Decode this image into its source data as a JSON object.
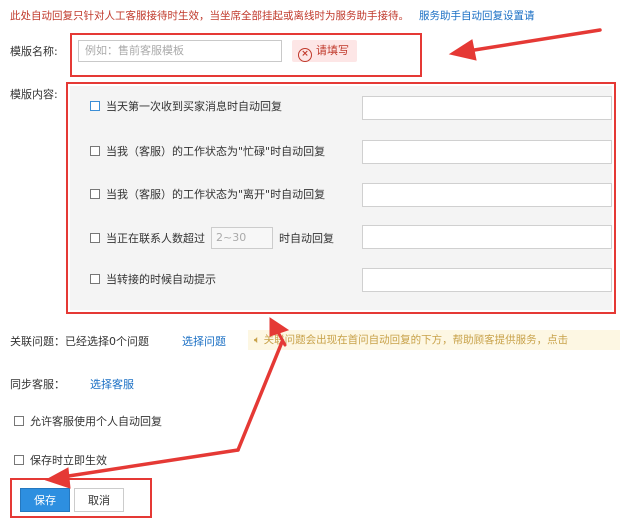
{
  "notice": {
    "warning": "此处自动回复只针对人工客服接待时生效，当坐席全部挂起或离线时为服务助手接待。",
    "link": "服务助手自动回复设置请"
  },
  "template_name": {
    "label": "模版名称:",
    "placeholder": "例如：售前客服模板",
    "error_icon": "close-circle-icon",
    "error": "请填写"
  },
  "template_content": {
    "label": "模版内容:",
    "rules": [
      {
        "label": "当天第一次收到买家消息时自动回复"
      },
      {
        "label": "当我（客服）的工作状态为\"忙碌\"时自动回复"
      },
      {
        "label": "当我（客服）的工作状态为\"离开\"时自动回复"
      },
      {
        "label_before": "当正在联系人数超过",
        "count_placeholder": "2~30",
        "label_after": "时自动回复"
      },
      {
        "label": "当转接的时候自动提示"
      }
    ]
  },
  "related": {
    "label": "关联问题：已经选择0个问题",
    "select_link": "选择问题",
    "tip_icon": "speaker-icon",
    "tip": "关联问题会出现在首问自动回复的下方，帮助顾客提供服务，点击"
  },
  "sync": {
    "label": "同步客服：",
    "select_link": "选择客服"
  },
  "allow_personal": "允许客服使用个人自动回复",
  "apply_on_save": "保存时立即生效",
  "buttons": {
    "save": "保存",
    "cancel": "取消"
  },
  "colors": {
    "annotation": "#e53935",
    "primary": "#2d8fe0",
    "link": "#1a6fc4",
    "error": "#c0392b"
  }
}
